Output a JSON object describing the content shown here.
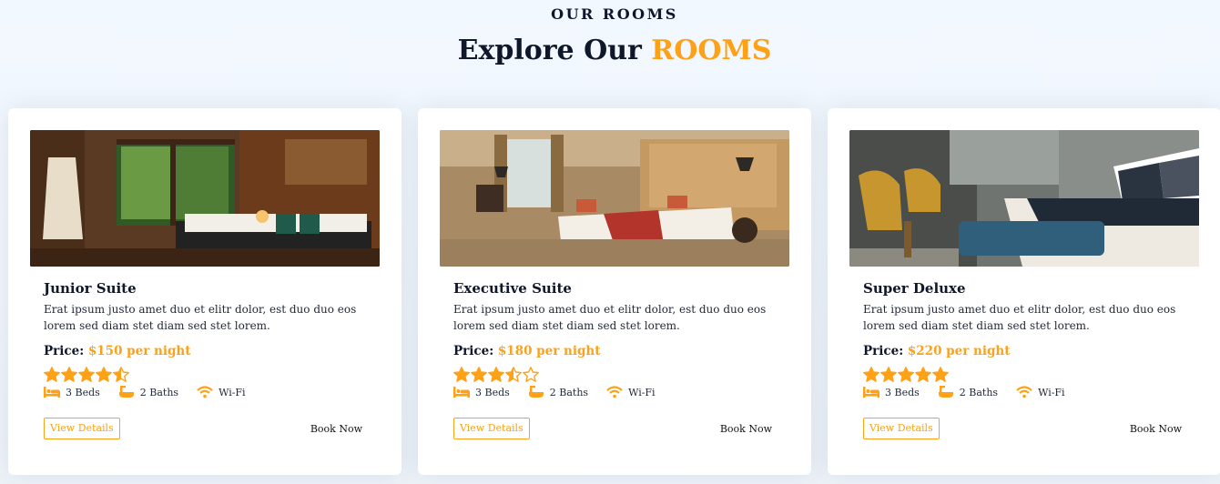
{
  "section": {
    "eyebrow": "OUR ROOMS",
    "heading_prefix": "Explore Our",
    "heading_accent": "ROOMS"
  },
  "colors": {
    "accent": "#fea116",
    "dark": "#0f172b",
    "star": "#fea116"
  },
  "rooms": [
    {
      "title": "Junior Suite",
      "description": "Erat ipsum justo amet duo et elitr dolor, est duo duo eos lorem sed diam stet diam sed stet lorem.",
      "price_label": "Price:",
      "price_value": "$150 per night",
      "rating": 4.5,
      "features": [
        {
          "icon": "bed-icon",
          "label": "3 Beds"
        },
        {
          "icon": "bath-icon",
          "label": "2 Baths"
        },
        {
          "icon": "wifi-icon",
          "label": "Wi-Fi"
        }
      ],
      "view_label": "View Details",
      "book_label": "Book Now"
    },
    {
      "title": "Executive Suite",
      "description": "Erat ipsum justo amet duo et elitr dolor, est duo duo eos lorem sed diam stet diam sed stet lorem.",
      "price_label": "Price:",
      "price_value": "$180 per night",
      "rating": 3.5,
      "features": [
        {
          "icon": "bed-icon",
          "label": "3 Beds"
        },
        {
          "icon": "bath-icon",
          "label": "2 Baths"
        },
        {
          "icon": "wifi-icon",
          "label": "Wi-Fi"
        }
      ],
      "view_label": "View Details",
      "book_label": "Book Now"
    },
    {
      "title": "Super Deluxe",
      "description": "Erat ipsum justo amet duo et elitr dolor, est duo duo eos lorem sed diam stet diam sed stet lorem.",
      "price_label": "Price:",
      "price_value": "$220 per night",
      "rating": 5,
      "features": [
        {
          "icon": "bed-icon",
          "label": "3 Beds"
        },
        {
          "icon": "bath-icon",
          "label": "2 Baths"
        },
        {
          "icon": "wifi-icon",
          "label": "Wi-Fi"
        }
      ],
      "view_label": "View Details",
      "book_label": "Book Now"
    }
  ]
}
